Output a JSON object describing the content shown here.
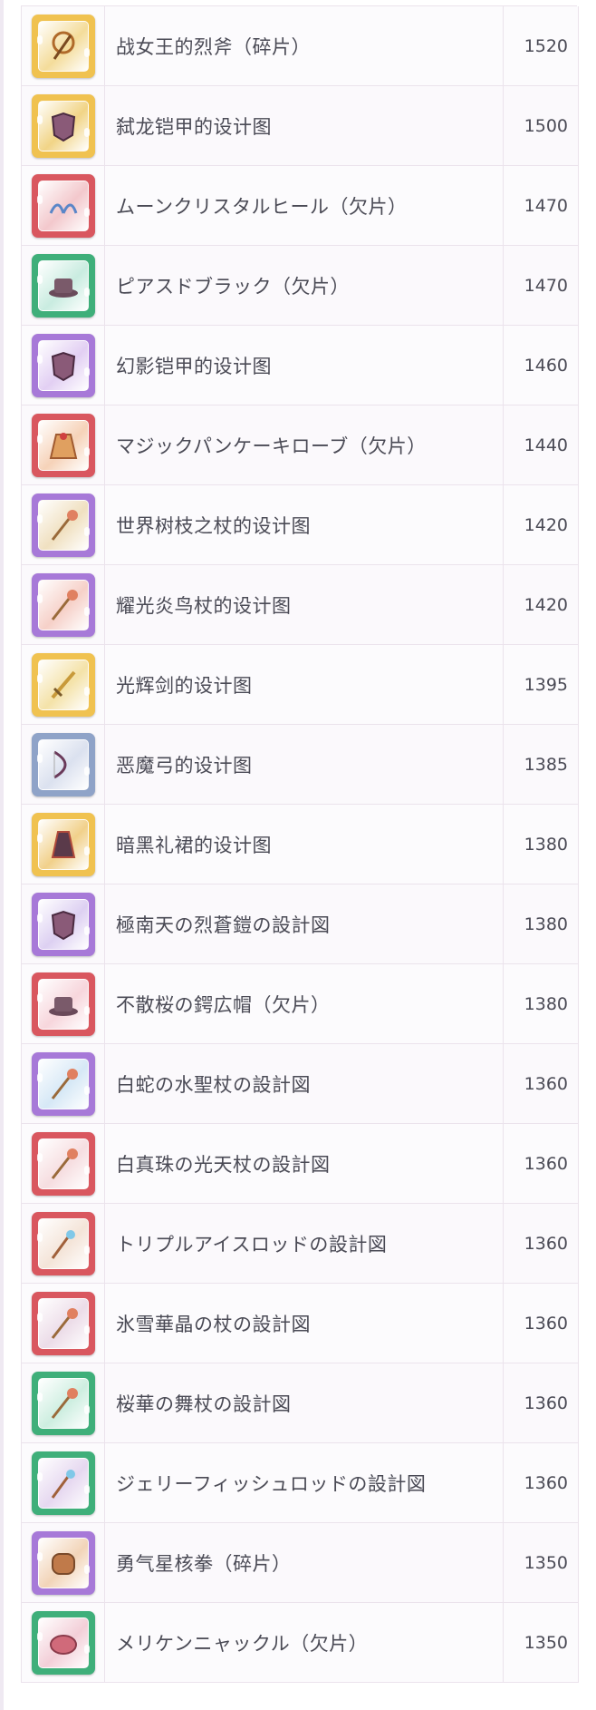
{
  "items": [
    {
      "name": "战女王的烈斧（碎片）",
      "value": "1520",
      "frame": "#f0c250",
      "tint": "#f4dc9a",
      "icon": "axe-icon"
    },
    {
      "name": "弑龙铠甲的设计图",
      "value": "1500",
      "frame": "#f0c250",
      "tint": "#f1d486",
      "icon": "armor-icon"
    },
    {
      "name": "ムーンクリスタルヒール（欠片）",
      "value": "1470",
      "frame": "#d9575f",
      "tint": "#f3c8cc",
      "icon": "heels-icon"
    },
    {
      "name": "ピアスドブラック（欠片）",
      "value": "1470",
      "frame": "#3faf7a",
      "tint": "#c9ece0",
      "icon": "hat-icon"
    },
    {
      "name": "幻影铠甲的设计图",
      "value": "1460",
      "frame": "#a779d8",
      "tint": "#e2cff3",
      "icon": "armor-icon"
    },
    {
      "name": "マジックパンケーキローブ（欠片）",
      "value": "1440",
      "frame": "#d9575f",
      "tint": "#f6d2b8",
      "icon": "robe-icon"
    },
    {
      "name": "世界树枝之杖的设计图",
      "value": "1420",
      "frame": "#a779d8",
      "tint": "#f0e0c0",
      "icon": "staff-icon"
    },
    {
      "name": "耀光炎鸟杖的设计图",
      "value": "1420",
      "frame": "#a779d8",
      "tint": "#f6d0c8",
      "icon": "staff-icon"
    },
    {
      "name": "光辉剑的设计图",
      "value": "1395",
      "frame": "#f0c250",
      "tint": "#f4e2a8",
      "icon": "sword-icon"
    },
    {
      "name": "恶魔弓的设计图",
      "value": "1385",
      "frame": "#8fa3c8",
      "tint": "#dbe1ef",
      "icon": "bow-icon"
    },
    {
      "name": "暗黑礼裙的设计图",
      "value": "1380",
      "frame": "#f0c250",
      "tint": "#f1d08a",
      "icon": "dress-icon"
    },
    {
      "name": "極南天の烈蒼鎧の設計図",
      "value": "1380",
      "frame": "#a779d8",
      "tint": "#ddd0f2",
      "icon": "armor-icon"
    },
    {
      "name": "不散桜の鍔広帽（欠片）",
      "value": "1380",
      "frame": "#d9575f",
      "tint": "#f7d6dc",
      "icon": "hat-icon"
    },
    {
      "name": "白蛇の水聖杖の設計図",
      "value": "1360",
      "frame": "#a779d8",
      "tint": "#d6e8f6",
      "icon": "staff-icon"
    },
    {
      "name": "白真珠の光天杖の設計図",
      "value": "1360",
      "frame": "#d9575f",
      "tint": "#f6dde0",
      "icon": "staff-icon"
    },
    {
      "name": "トリプルアイスロッドの設計図",
      "value": "1360",
      "frame": "#d9575f",
      "tint": "#f4e4d8",
      "icon": "rod-icon"
    },
    {
      "name": "氷雪華晶の杖の設計図",
      "value": "1360",
      "frame": "#d9575f",
      "tint": "#ecdce8",
      "icon": "staff-icon"
    },
    {
      "name": "桜華の舞杖の設計図",
      "value": "1360",
      "frame": "#3faf7a",
      "tint": "#cdeee0",
      "icon": "staff-icon"
    },
    {
      "name": "ジェリーフィッシュロッドの設計図",
      "value": "1360",
      "frame": "#3faf7a",
      "tint": "#e6d8f0",
      "icon": "rod-icon"
    },
    {
      "name": "勇气星核拳（碎片）",
      "value": "1350",
      "frame": "#a779d8",
      "tint": "#f2d4b8",
      "icon": "fist-icon"
    },
    {
      "name": "メリケンニャックル（欠片）",
      "value": "1350",
      "frame": "#3faf7a",
      "tint": "#f3cfd8",
      "icon": "knuckle-icon"
    }
  ]
}
